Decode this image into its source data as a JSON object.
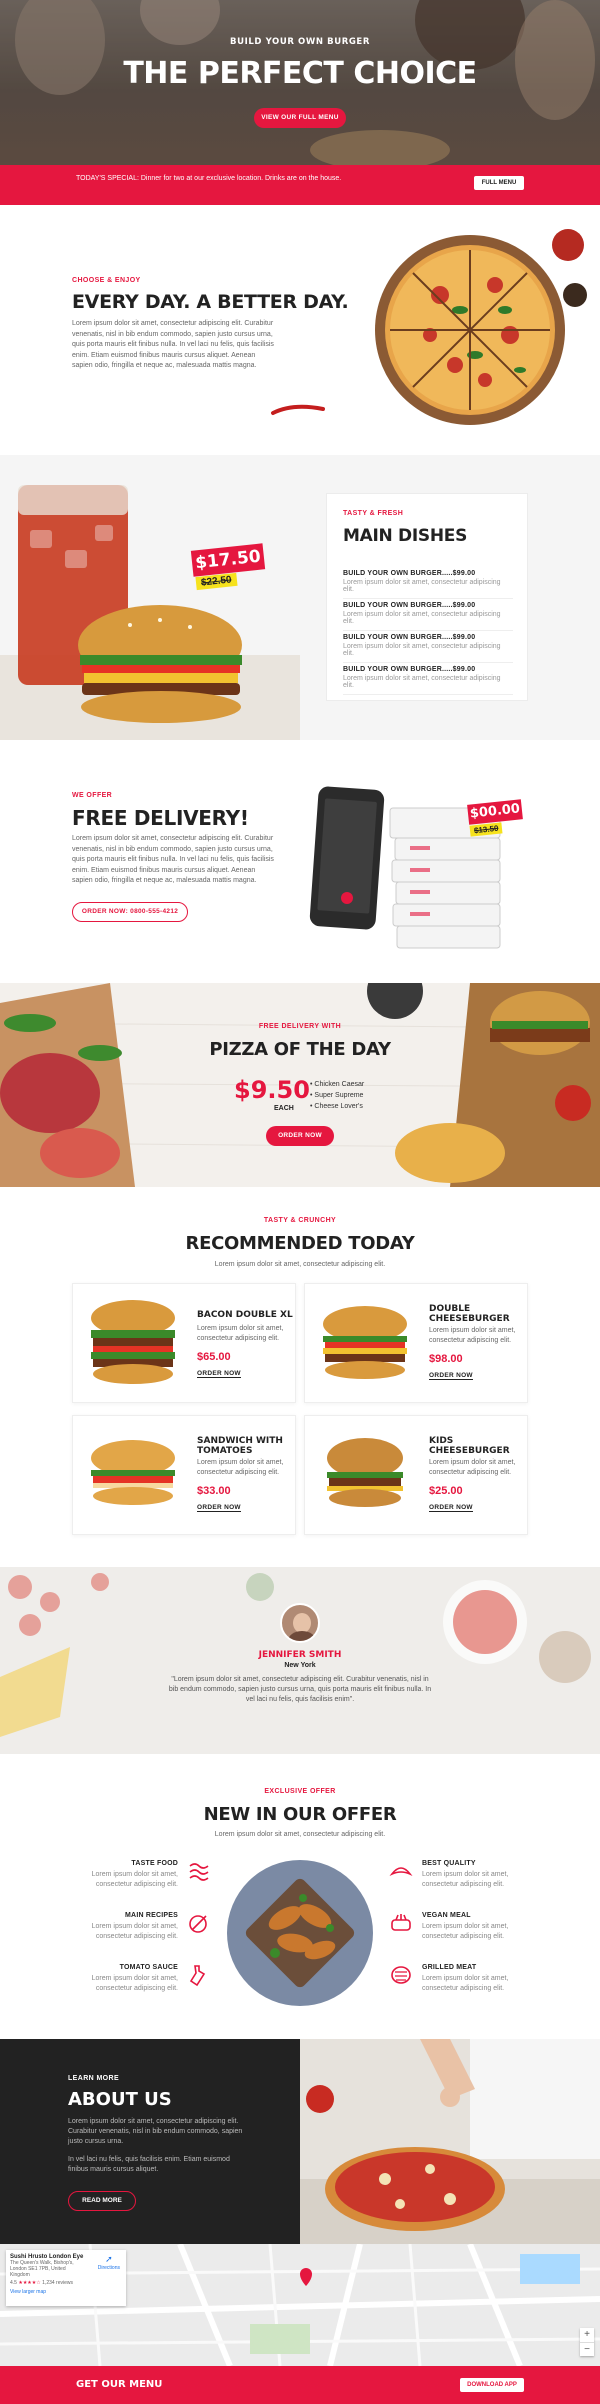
{
  "hero": {
    "eyebrow": "BUILD YOUR OWN BURGER",
    "title": "THE PERFECT CHOICE",
    "button": "VIEW OUR FULL MENU"
  },
  "special_bar": {
    "text": "TODAY'S SPECIAL: Dinner for two at our exclusive location. Drinks are on the house.",
    "button": "FULL MENU"
  },
  "about_intro": {
    "eyebrow": "CHOOSE & ENJOY",
    "title": "EVERY DAY. A BETTER DAY.",
    "body": "Lorem ipsum dolor sit amet, consectetur adipiscing elit. Curabitur venenatis, nisl in bib endum commodo, sapien justo cursus urna, quis porta mauris elit finibus nulla. In vel laci nu felis, quis facilisis enim. Etiam euismod finibus mauris cursus aliquet. Aenean sapien odio, fringilla et neque ac, malesuada mattis magna."
  },
  "main_dishes": {
    "price_tag": "$17.50",
    "old_price": "$22.50",
    "eyebrow": "TASTY & FRESH",
    "title": "MAIN DISHES",
    "items": [
      {
        "name": "BUILD YOUR OWN BURGER.....$99.00",
        "desc": "Lorem ipsum dolor sit amet, consectetur adipiscing elit."
      },
      {
        "name": "BUILD YOUR OWN BURGER.....$99.00",
        "desc": "Lorem ipsum dolor sit amet, consectetur adipiscing elit."
      },
      {
        "name": "BUILD YOUR OWN BURGER.....$99.00",
        "desc": "Lorem ipsum dolor sit amet, consectetur adipiscing elit."
      },
      {
        "name": "BUILD YOUR OWN BURGER.....$99.00",
        "desc": "Lorem ipsum dolor sit amet, consectetur adipiscing elit."
      }
    ]
  },
  "delivery": {
    "eyebrow": "WE OFFER",
    "title": "FREE DELIVERY!",
    "body": "Lorem ipsum dolor sit amet, consectetur adipiscing elit. Curabitur venenatis, nisl in bib endum commodo, sapien justo cursus urna, quis porta mauris elit finibus nulla. In vel laci nu felis, quis facilisis enim. Etiam euismod finibus mauris cursus aliquet. Aenean sapien odio, fringilla et neque ac, malesuada mattis magna.",
    "button": "ORDER NOW: 0800-555-4212",
    "price_tag": "$00.00",
    "old_price": "$13.50"
  },
  "pizza_day": {
    "eyebrow": "FREE DELIVERY WITH",
    "title": "PIZZA OF THE DAY",
    "price": "$9.50",
    "each": "EACH",
    "options": [
      "Chicken Caesar",
      "Super Supreme",
      "Cheese Lover's"
    ],
    "button": "ORDER NOW"
  },
  "recommended": {
    "eyebrow": "TASTY & CRUNCHY",
    "title": "RECOMMENDED TODAY",
    "subtitle": "Lorem ipsum dolor sit amet, consectetur adipiscing elit.",
    "order_label": "ORDER NOW",
    "items": [
      {
        "name": "BACON DOUBLE XL",
        "desc": "Lorem ipsum dolor sit amet, consectetur adipiscing elit.",
        "price": "$65.00"
      },
      {
        "name": "DOUBLE CHEESEBURGER",
        "desc": "Lorem ipsum dolor sit amet, consectetur adipiscing elit.",
        "price": "$98.00"
      },
      {
        "name": "SANDWICH WITH TOMATOES",
        "desc": "Lorem ipsum dolor sit amet, consectetur adipiscing elit.",
        "price": "$33.00"
      },
      {
        "name": "KIDS CHEESEBURGER",
        "desc": "Lorem ipsum dolor sit amet, consectetur adipiscing elit.",
        "price": "$25.00"
      }
    ]
  },
  "testimonial": {
    "name": "JENNIFER SMITH",
    "location": "New York",
    "quote": "\"Lorem ipsum dolor sit amet, consectetur adipiscing elit. Curabitur venenatis, nisl in bib endum commodo, sapien justo cursus urna, quis porta mauris elit finibus nulla. In vel laci nu felis, quis facilisis enim\"."
  },
  "offer": {
    "eyebrow": "EXCLUSIVE OFFER",
    "title": "NEW IN OUR OFFER",
    "subtitle": "Lorem ipsum dolor sit amet, consectetur adipiscing elit.",
    "left": [
      {
        "title": "TASTE FOOD",
        "desc": "Lorem ipsum dolor sit amet, consectetur adipiscing elit."
      },
      {
        "title": "MAIN RECIPES",
        "desc": "Lorem ipsum dolor sit amet, consectetur adipiscing elit."
      },
      {
        "title": "TOMATO SAUCE",
        "desc": "Lorem ipsum dolor sit amet, consectetur adipiscing elit."
      }
    ],
    "right": [
      {
        "title": "BEST QUALITY",
        "desc": "Lorem ipsum dolor sit amet, consectetur adipiscing elit."
      },
      {
        "title": "VEGAN MEAL",
        "desc": "Lorem ipsum dolor sit amet, consectetur adipiscing elit."
      },
      {
        "title": "GRILLED MEAT",
        "desc": "Lorem ipsum dolor sit amet, consectetur adipiscing elit."
      }
    ]
  },
  "about": {
    "eyebrow": "LEARN MORE",
    "title": "ABOUT US",
    "body1": "Lorem ipsum dolor sit amet, consectetur adipiscing elit. Curabitur venenatis, nisl in bib endum commodo, sapien justo cursus urna.",
    "body2": "In vel laci nu felis, quis facilisis enim. Etiam euismod finibus mauris cursus aliquet.",
    "button": "READ MORE"
  },
  "map": {
    "place": "Sushi Hrusto London Eye",
    "address": "The Queen's Walk, Bishop's, London SE1 7PB, United Kingdom",
    "rating": "4.5",
    "reviews": "1,234 reviews",
    "directions": "Directions",
    "larger_map": "View larger map"
  },
  "footer": {
    "text": "GET OUR MENU",
    "button": "DOWNLOAD APP"
  },
  "colors": {
    "accent": "#e5173f",
    "dark": "#222222"
  }
}
